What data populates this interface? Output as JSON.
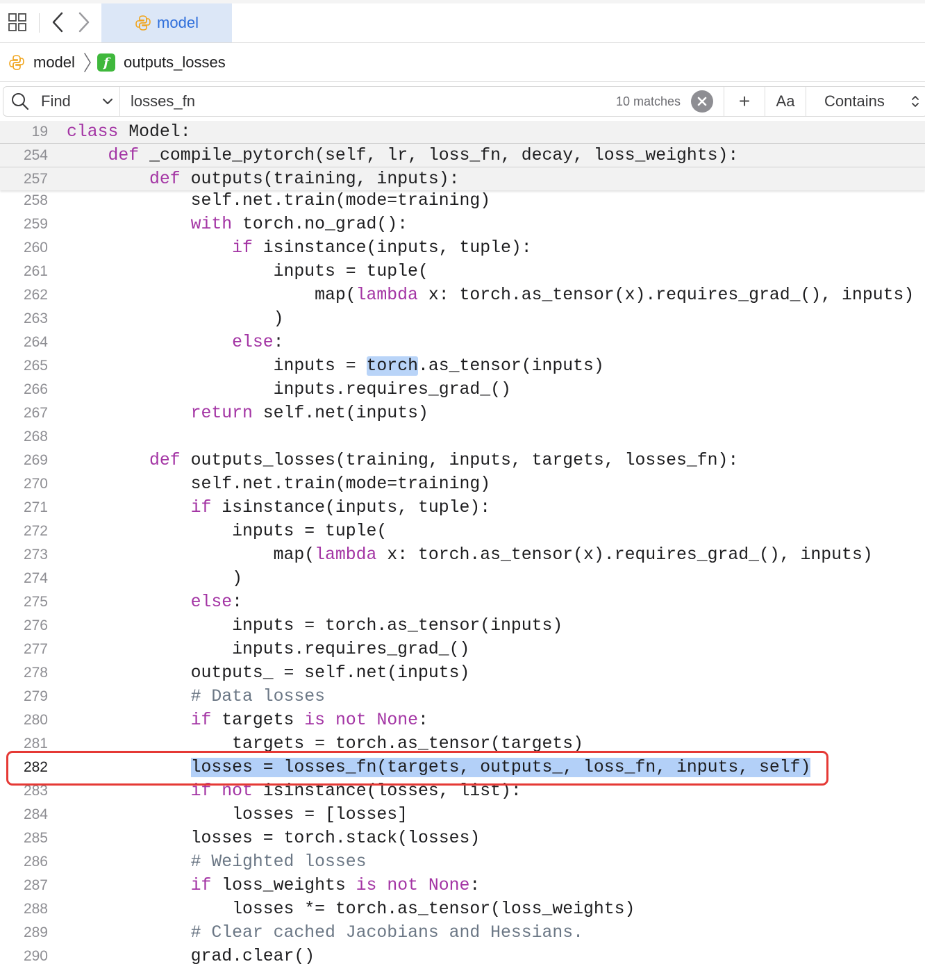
{
  "tabbar": {
    "active_tab": "model"
  },
  "breadcrumb": {
    "module": "model",
    "function": "outputs_losses",
    "function_icon_glyph": "f"
  },
  "find": {
    "mode": "Find",
    "query": "losses_fn",
    "matches": "10 matches",
    "plus": "+",
    "case": "Aa",
    "match_type": "Contains"
  },
  "sticky": [
    {
      "ln": "19",
      "tokens": [
        {
          "t": "class",
          "k": "kw"
        },
        {
          "t": " Model:"
        }
      ]
    },
    {
      "ln": "254",
      "tokens": [
        {
          "t": "    "
        },
        {
          "t": "def",
          "k": "kw"
        },
        {
          "t": " _compile_pytorch(self, lr, loss_fn, decay, loss_weights):"
        }
      ]
    },
    {
      "ln": "257",
      "tokens": [
        {
          "t": "        "
        },
        {
          "t": "def",
          "k": "kw"
        },
        {
          "t": " outputs(training, inputs):"
        }
      ]
    }
  ],
  "lines": [
    {
      "ln": "258",
      "tokens": [
        {
          "t": "            self.net.train(mode=training)"
        }
      ]
    },
    {
      "ln": "259",
      "tokens": [
        {
          "t": "            "
        },
        {
          "t": "with",
          "k": "kw"
        },
        {
          "t": " torch.no_grad():"
        }
      ]
    },
    {
      "ln": "260",
      "tokens": [
        {
          "t": "                "
        },
        {
          "t": "if",
          "k": "kw"
        },
        {
          "t": " isinstance(inputs, tuple):"
        }
      ]
    },
    {
      "ln": "261",
      "tokens": [
        {
          "t": "                    inputs = tuple("
        }
      ]
    },
    {
      "ln": "262",
      "tokens": [
        {
          "t": "                        map("
        },
        {
          "t": "lambda",
          "k": "kw"
        },
        {
          "t": " x: torch.as_tensor(x).requires_grad_(), inputs)"
        }
      ]
    },
    {
      "ln": "263",
      "tokens": [
        {
          "t": "                    )"
        }
      ]
    },
    {
      "ln": "264",
      "tokens": [
        {
          "t": "                "
        },
        {
          "t": "else",
          "k": "kw"
        },
        {
          "t": ":"
        }
      ]
    },
    {
      "ln": "265",
      "tokens": [
        {
          "t": "                    inputs = "
        },
        {
          "t": "torch",
          "k": "hl"
        },
        {
          "t": ".as_tensor(inputs)"
        }
      ]
    },
    {
      "ln": "266",
      "tokens": [
        {
          "t": "                    inputs.requires_grad_()"
        }
      ]
    },
    {
      "ln": "267",
      "tokens": [
        {
          "t": "            "
        },
        {
          "t": "return",
          "k": "kw"
        },
        {
          "t": " self.net(inputs)"
        }
      ]
    },
    {
      "ln": "268",
      "tokens": [
        {
          "t": ""
        }
      ]
    },
    {
      "ln": "269",
      "tokens": [
        {
          "t": "        "
        },
        {
          "t": "def",
          "k": "kw"
        },
        {
          "t": " outputs_losses(training, inputs, targets, losses_fn):"
        }
      ]
    },
    {
      "ln": "270",
      "tokens": [
        {
          "t": "            self.net.train(mode=training)"
        }
      ]
    },
    {
      "ln": "271",
      "tokens": [
        {
          "t": "            "
        },
        {
          "t": "if",
          "k": "kw"
        },
        {
          "t": " isinstance(inputs, tuple):"
        }
      ]
    },
    {
      "ln": "272",
      "tokens": [
        {
          "t": "                inputs = tuple("
        }
      ]
    },
    {
      "ln": "273",
      "tokens": [
        {
          "t": "                    map("
        },
        {
          "t": "lambda",
          "k": "kw"
        },
        {
          "t": " x: torch.as_tensor(x).requires_grad_(), inputs)"
        }
      ]
    },
    {
      "ln": "274",
      "tokens": [
        {
          "t": "                )"
        }
      ]
    },
    {
      "ln": "275",
      "tokens": [
        {
          "t": "            "
        },
        {
          "t": "else",
          "k": "kw"
        },
        {
          "t": ":"
        }
      ]
    },
    {
      "ln": "276",
      "tokens": [
        {
          "t": "                inputs = torch.as_tensor(inputs)"
        }
      ]
    },
    {
      "ln": "277",
      "tokens": [
        {
          "t": "                inputs.requires_grad_()"
        }
      ]
    },
    {
      "ln": "278",
      "tokens": [
        {
          "t": "            outputs_ = self.net(inputs)"
        }
      ]
    },
    {
      "ln": "279",
      "tokens": [
        {
          "t": "            "
        },
        {
          "t": "# Data losses",
          "k": "cm"
        }
      ]
    },
    {
      "ln": "280",
      "tokens": [
        {
          "t": "            "
        },
        {
          "t": "if",
          "k": "kw"
        },
        {
          "t": " targets "
        },
        {
          "t": "is",
          "k": "kw"
        },
        {
          "t": " "
        },
        {
          "t": "not",
          "k": "kw"
        },
        {
          "t": " "
        },
        {
          "t": "None",
          "k": "kw"
        },
        {
          "t": ":"
        }
      ]
    },
    {
      "ln": "281",
      "tokens": [
        {
          "t": "                targets = torch.as_tensor(targets)"
        }
      ]
    },
    {
      "ln": "282",
      "current": true,
      "tokens": [
        {
          "t": "            "
        },
        {
          "t": "losses = losses_fn(targets, outputs_, loss_fn, inputs, self)",
          "k": "cur"
        }
      ]
    },
    {
      "ln": "283",
      "tokens": [
        {
          "t": "            "
        },
        {
          "t": "if",
          "k": "kw"
        },
        {
          "t": " "
        },
        {
          "t": "not",
          "k": "kw"
        },
        {
          "t": " isinstance(losses, list):"
        }
      ]
    },
    {
      "ln": "284",
      "tokens": [
        {
          "t": "                losses = [losses]"
        }
      ]
    },
    {
      "ln": "285",
      "tokens": [
        {
          "t": "            losses = torch.stack(losses)"
        }
      ]
    },
    {
      "ln": "286",
      "tokens": [
        {
          "t": "            "
        },
        {
          "t": "# Weighted losses",
          "k": "cm"
        }
      ]
    },
    {
      "ln": "287",
      "tokens": [
        {
          "t": "            "
        },
        {
          "t": "if",
          "k": "kw"
        },
        {
          "t": " loss_weights "
        },
        {
          "t": "is",
          "k": "kw"
        },
        {
          "t": " "
        },
        {
          "t": "not",
          "k": "kw"
        },
        {
          "t": " "
        },
        {
          "t": "None",
          "k": "kw"
        },
        {
          "t": ":"
        }
      ]
    },
    {
      "ln": "288",
      "tokens": [
        {
          "t": "                losses *= torch.as_tensor(loss_weights)"
        }
      ]
    },
    {
      "ln": "289",
      "tokens": [
        {
          "t": "            "
        },
        {
          "t": "# Clear cached Jacobians and Hessians.",
          "k": "cm"
        }
      ]
    },
    {
      "ln": "290",
      "tokens": [
        {
          "t": "            grad.clear()"
        }
      ]
    }
  ],
  "colors": {
    "keyword": "#a334a4",
    "comment": "#6b7785",
    "active_tab_bg": "#dce7f7",
    "active_tab_text": "#2f6fdb",
    "selection": "#b3d0f8",
    "annotation_box": "#e53935"
  },
  "icons": {
    "grid": "grid-icon",
    "back": "chevron-left-icon",
    "forward": "chevron-right-icon",
    "python": "python-icon",
    "function": "function-icon",
    "search": "search-icon",
    "clear": "clear-icon",
    "stepper": "up-down-chevron-icon"
  }
}
